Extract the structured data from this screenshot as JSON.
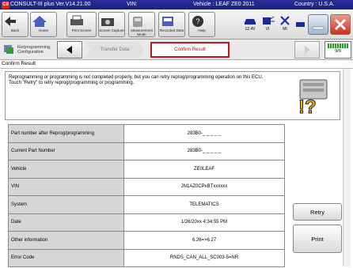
{
  "titlebar": {
    "logo": "CII",
    "app": "CONSULT-III plus  Ver.V14.21.00",
    "vin": "VIN:",
    "vehicle": "Vehicle : LEAF ZE0 2011",
    "country": "Country : U.S.A."
  },
  "toolbar": {
    "back": "Back",
    "home": "Home",
    "print_screen": "Print Screen",
    "screen_capture": "Screen Capture",
    "measurement_mode": "Measurement Mode",
    "recorded_data": "Recorded Data",
    "help": "Help",
    "voltage": "12.4V",
    "vi": "VI",
    "mi": "MI"
  },
  "stepbar": {
    "crumb": "Re/programming, Configuration",
    "done_step": "Transfer Data",
    "current_step": "Confirm Result",
    "page": "9/9"
  },
  "section_title": "Confirm Result",
  "message": "Reprogramming or programming is not completed properly, but you can retry reprog/programming operation on this ECU. Touch \"Retry\" to retry reprog/programming or programming.",
  "result_rows": [
    {
      "label": "Part number after Reprog/programming",
      "value": "283B0-_ _ _ _ _"
    },
    {
      "label": "Current Part Number",
      "value": "283B0-_ _ _ _ _"
    },
    {
      "label": "Vehicle",
      "value": "ZE0LEAF"
    },
    {
      "label": "VIN",
      "value": "JN1AZ0CPxBTxxxxxx"
    },
    {
      "label": "System",
      "value": "TELEMATICS"
    },
    {
      "label": "Date",
      "value": "1/26/20xx 4:34:55 PM"
    },
    {
      "label": "Other information",
      "value": "6.26=>6.27"
    },
    {
      "label": "Error Code",
      "value": "RNDS_CAN_ALL_SC003-5=NR"
    }
  ],
  "buttons": {
    "retry": "Retry",
    "print": "Print"
  }
}
